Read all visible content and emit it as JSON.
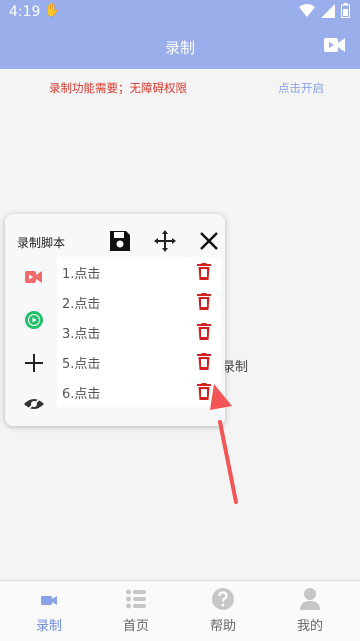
{
  "status_bar": {
    "time": "4:19"
  },
  "app_bar": {
    "title": "录制"
  },
  "notice": "录制功能需要；无障碍权限",
  "open_link": "点击开启",
  "background_text": "录制",
  "panel": {
    "title": "录制脚本",
    "steps": [
      {
        "label": "1.点击"
      },
      {
        "label": "2.点击"
      },
      {
        "label": "3.点击"
      },
      {
        "label": "5.点击"
      },
      {
        "label": "6.点击"
      }
    ]
  },
  "tabs": [
    {
      "label": "录制",
      "icon": "video-camera-icon",
      "active": true
    },
    {
      "label": "首页",
      "icon": "list-icon",
      "active": false
    },
    {
      "label": "帮助",
      "icon": "help-icon",
      "active": false
    },
    {
      "label": "我的",
      "icon": "user-icon",
      "active": false
    }
  ],
  "colors": {
    "accent": "#9aaeec",
    "danger": "#d32020",
    "active_tab": "#6e8ce0"
  }
}
